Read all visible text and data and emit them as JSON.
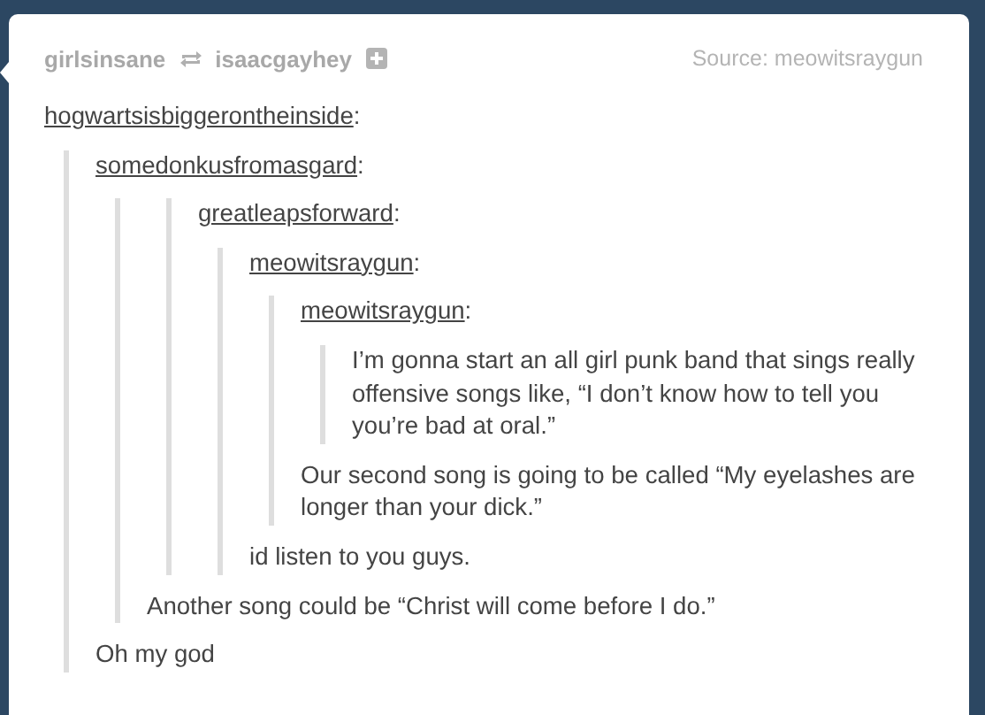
{
  "header": {
    "poster": "girlsinsane",
    "reblogged_from": "isaacgayhey",
    "source_label": "Source:",
    "source": "meowitsraygun"
  },
  "post": {
    "author": "hogwartsisbiggerontheinside",
    "colon": ":",
    "quote": {
      "author": "somedonkusfromasgard",
      "colon": ":",
      "quote": {
        "quote": {
          "author": "greatleapsforward",
          "colon": ":",
          "quote": {
            "author": "meowitsraygun",
            "colon": ":",
            "quote": {
              "author": "meowitsraygun",
              "colon": ":",
              "quote": {
                "text": "I’m gonna start an all girl punk band that sings really offensive songs like, “I don’t know how to tell you you’re bad at oral.”"
              },
              "text": "Our second song is going to be called “My eyelashes are longer than your dick.”"
            },
            "text": "id listen to you guys."
          }
        },
        "text": "Another song could be “Christ will come before I do.”"
      },
      "text": "Oh my god"
    }
  }
}
